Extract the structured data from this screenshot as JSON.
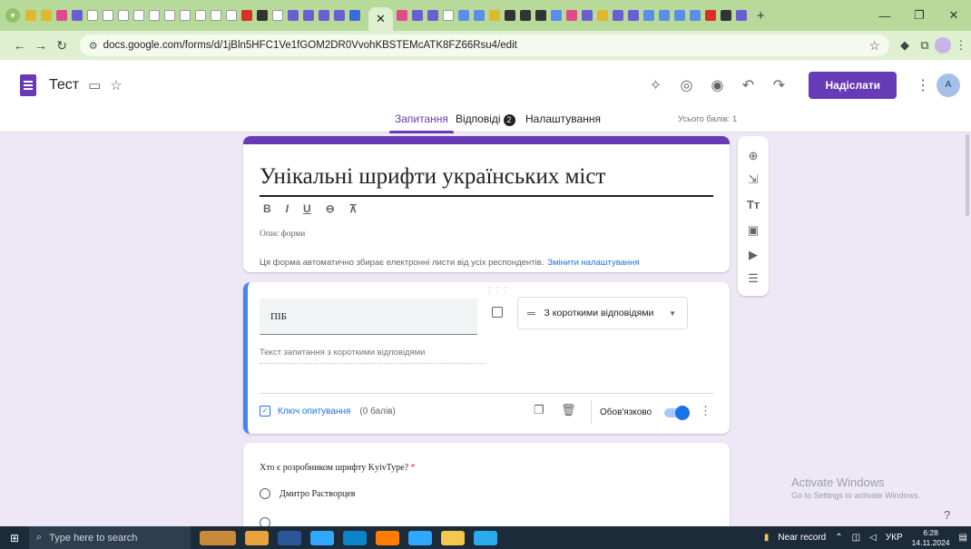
{
  "browser": {
    "url": "docs.google.com/forms/d/1jBln5HFC1Ve1fGOM2DR0VvohKBSTEMcATK8FZ66Rsu4/edit",
    "new_tab": "+",
    "win_min": "—",
    "win_max": "❐",
    "win_close": "✕",
    "tab_close": "✕"
  },
  "header": {
    "doc_title": "Тест",
    "send_label": "Надіслати",
    "account_initials": "A"
  },
  "tabs": {
    "questions": "Запитання",
    "responses": "Відповіді",
    "responses_count": "2",
    "settings": "Налаштування",
    "total_points": "Усього балів: 1"
  },
  "title_card": {
    "title": "Унікальні шрифти українських міст",
    "description_placeholder": "Опис форми",
    "email_note": "Ця форма автоматично збирає електронні листи від усіх респондентів.",
    "change_settings_link": "Змінити налаштування",
    "format_bold": "B",
    "format_italic": "I",
    "format_underline": "U"
  },
  "question1": {
    "title": "ПІБ",
    "type": "З короткими відповідями",
    "answer_placeholder": "Текст запитання з короткими відповідями",
    "answer_key_label": "Ключ опитування",
    "points": "(0 балів)",
    "required_label": "Обов'язково",
    "required": true
  },
  "question2": {
    "title": "Хто є розробником шрифту KyivType?",
    "required_mark": "*",
    "options": [
      "Дмитро Растворцев"
    ]
  },
  "watermark": {
    "title": "Activate Windows",
    "subtitle": "Go to Settings to activate Windows."
  },
  "taskbar": {
    "search_placeholder": "Type here to search",
    "weather": "Near record",
    "language": "УКР",
    "time": "6:28",
    "date": "14.11.2024"
  }
}
